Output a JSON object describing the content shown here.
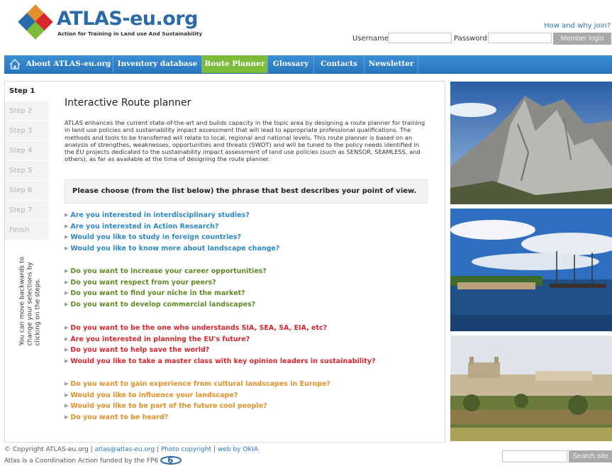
{
  "header": {
    "logo_title": "ATLAS-eu.org",
    "logo_subtitle": "Action for Training in Land use And Sustainability",
    "join_link": "How and why join?",
    "username_label": "Username:",
    "password_label": "Password:",
    "username_value": "",
    "password_value": "",
    "login_button": "Member login"
  },
  "nav": {
    "home_icon": "home-icon",
    "items": [
      "About ATLAS-eu.org",
      "Inventory database",
      "Route Planner",
      "Glossary",
      "Contacts",
      "Newsletter"
    ],
    "active": "Route Planner"
  },
  "steps": {
    "items": [
      "Step 1",
      "Step 2",
      "Step 3",
      "Step 4",
      "Step 5",
      "Step 6",
      "Step 7",
      "Finish"
    ],
    "current": "Step 1",
    "note": "You can move backwards to change your selections by clicking on the steps."
  },
  "content": {
    "title": "Interactive Route planner",
    "intro": "ATLAS enhances the current state-of-the-art and builds capacity in the topic area by designing a route planner for training in land use policies and sustainability impact assessment that will lead to appropriate professional qualifications. The methods and tools to be transferred will relate to local, regional and national levels. This route planner is based on an analysis of strengthes, weaknesses, opportunities and threats (SWOT) and will be tuned to the policy needs identified in the EU projects dedicated to the sustainability impact assessment of land use policies (such as SENSOR, SEAMLESS, and others), as far as available at the time of designing the route planner.",
    "choose_prompt": "Please choose (from the list below) the phrase that best describes your point of view.",
    "question_groups": [
      {
        "color": "#2b88c8",
        "questions": [
          "Are you interested in interdisciplinary studies?",
          "Are you interested in Action Research?",
          "Would you like to study in foreign countries?",
          "Would you like to know more about landscape change?"
        ]
      },
      {
        "color": "#5f8a26",
        "questions": [
          "Do you want to increase your career opportunities?",
          "Do you want respect from your peers?",
          "Do you want to find your niche in the market?",
          "Do you want to develop commercial landscapes?"
        ]
      },
      {
        "color": "#d8262e",
        "questions": [
          "Do you want to be the one who understands SIA, SEA, SA, EIA, etc?",
          "Are you interested in planning the EU's future?",
          "Do you want to help save the world?",
          "Would you like to take a master class with key opinion leaders in sustainability?"
        ]
      },
      {
        "color": "#e2902c",
        "questions": [
          "Do you want to gain experience from cultural landscapes in Europe?",
          "Would you like to influence your landscape?",
          "Would you like to be part of the future cool people?",
          "Do you want to be heard?"
        ]
      }
    ]
  },
  "footer": {
    "copyright": "© Copyright ATLAS-eu.org",
    "email": "atlas@atlas-eu.org",
    "photo_link": "Photo copyright",
    "web_link": "web by OKIA",
    "funding": "Atlas is a Coordination Action funded by the FP6",
    "search_value": "",
    "search_button": "Search site"
  },
  "colors": {
    "brand_blue": "#2b6aa8",
    "nav_blue": "#2f80c6",
    "nav_active": "#7dbb3a"
  }
}
